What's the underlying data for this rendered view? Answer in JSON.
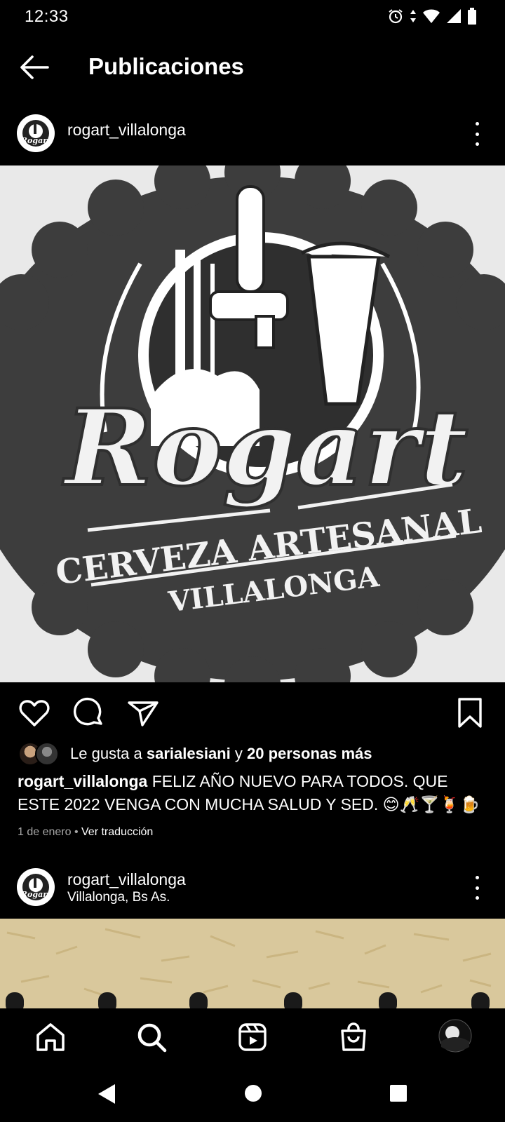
{
  "status_bar": {
    "time": "12:33"
  },
  "header": {
    "title": "Publicaciones"
  },
  "post1": {
    "username": "rogart_villalonga",
    "logo_text": {
      "brand": "Rogart",
      "line1": "CERVEZA ARTESANAL",
      "line2": "VILLALONGA"
    },
    "likes": {
      "prefix": "Le gusta a ",
      "user": "sarialesiani",
      "middle": " y ",
      "others": "20 personas más"
    },
    "caption": {
      "username": "rogart_villalonga",
      "text": " FELIZ AÑO NUEVO PARA TODOS. QUE ESTE 2022 VENGA CON MUCHA SALUD Y SED. 😊🥂🍸🍹🍺"
    },
    "date": "1 de enero",
    "separator": " • ",
    "translate": "Ver traducción"
  },
  "post2": {
    "username": "rogart_villalonga",
    "location": "Villalonga, Bs As."
  },
  "icons": {
    "back": "arrow-left-icon",
    "like": "heart-icon",
    "comment": "comment-icon",
    "share": "send-icon",
    "save": "bookmark-icon",
    "more": "more-vertical-icon",
    "home": "home-icon",
    "search": "search-icon",
    "reels": "reels-icon",
    "shop": "shop-icon",
    "profile": "profile-avatar-icon"
  }
}
